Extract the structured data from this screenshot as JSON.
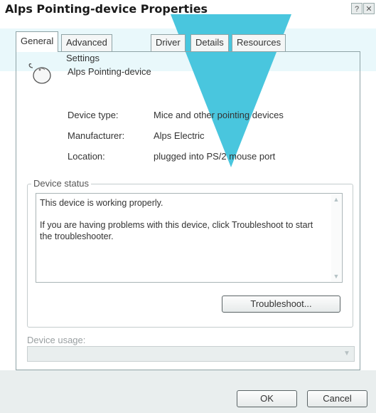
{
  "window": {
    "title": "Alps Pointing-device Properties",
    "help_glyph": "?",
    "close_glyph": "✕"
  },
  "tabs": [
    {
      "label": "General",
      "active": true
    },
    {
      "label": "Advanced Settings",
      "active": false
    },
    {
      "label": "Driver",
      "active": false
    },
    {
      "label": "Details",
      "active": false
    },
    {
      "label": "Resources",
      "active": false
    }
  ],
  "device": {
    "name": "Alps Pointing-device",
    "icon": "mouse-icon",
    "properties": [
      {
        "label": "Device type:",
        "value": "Mice and other pointing devices"
      },
      {
        "label": "Manufacturer:",
        "value": "Alps Electric"
      },
      {
        "label": "Location:",
        "value": "plugged into PS/2 mouse port"
      }
    ]
  },
  "status": {
    "legend": "Device status",
    "line1": "This device is working properly.",
    "line2": "If you are having problems with this device, click Troubleshoot to start the troubleshooter.",
    "troubleshoot_label": "Troubleshoot..."
  },
  "usage": {
    "label": "Device usage:",
    "selected": ""
  },
  "footer": {
    "ok_label": "OK",
    "cancel_label": "Cancel"
  },
  "colors": {
    "accent_cyan": "#49c6de",
    "border": "#8fa3a6"
  }
}
